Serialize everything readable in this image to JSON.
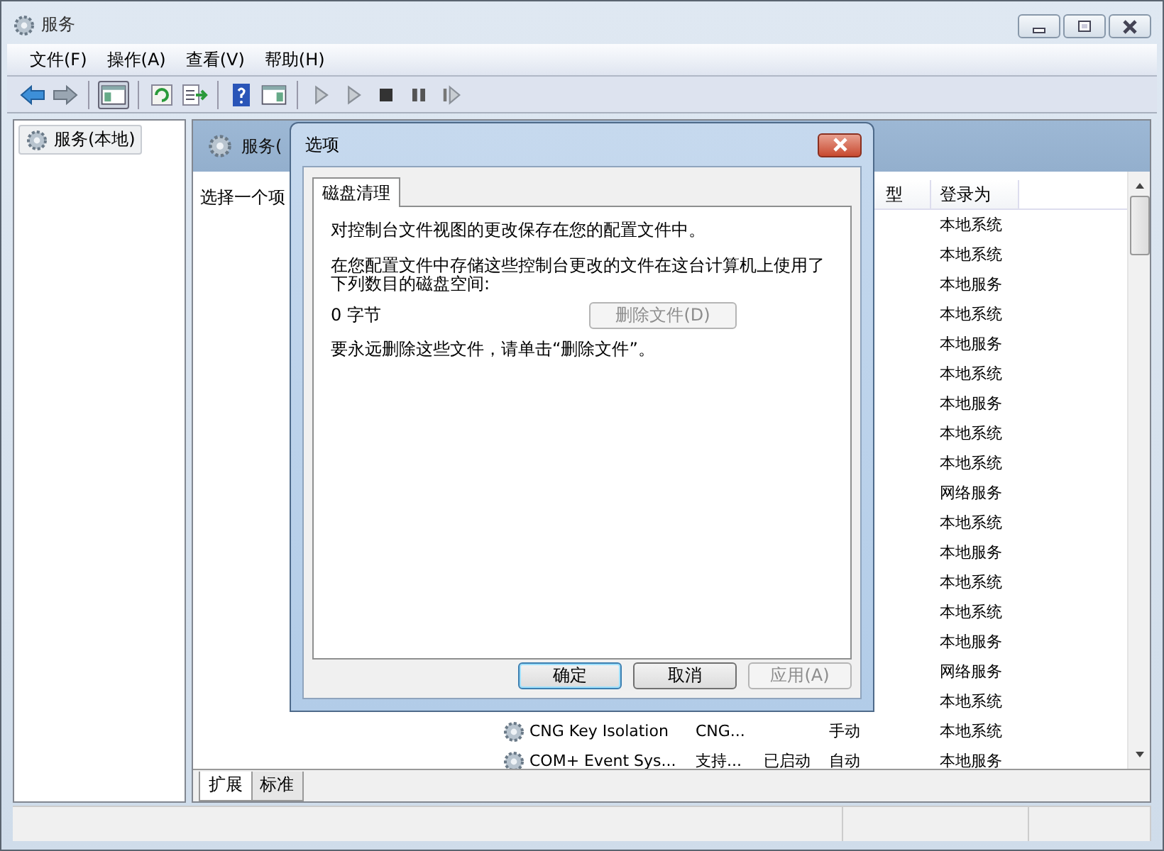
{
  "window": {
    "title": "服务"
  },
  "menu": [
    {
      "label": "文件(F)"
    },
    {
      "label": "操作(A)"
    },
    {
      "label": "查看(V)"
    },
    {
      "label": "帮助(H)"
    }
  ],
  "tree": [
    {
      "label": "服务(本地)",
      "selected": true
    }
  ],
  "pane": {
    "title": "服务(",
    "description": "选择一个项",
    "headers": [
      "型",
      "登录为"
    ],
    "rows": [
      {
        "login": "本地系统"
      },
      {
        "login": "本地系统"
      },
      {
        "login": "本地服务"
      },
      {
        "login": "本地系统"
      },
      {
        "login": "本地服务"
      },
      {
        "login": "本地系统"
      },
      {
        "login": "本地服务"
      },
      {
        "login": "本地系统"
      },
      {
        "login": "本地系统"
      },
      {
        "login": "网络服务"
      },
      {
        "login": "本地系统"
      },
      {
        "login": "本地服务"
      },
      {
        "login": "本地系统"
      },
      {
        "login": "本地系统"
      },
      {
        "login": "本地服务"
      },
      {
        "login": "网络服务"
      },
      {
        "login": "本地系统"
      },
      {
        "name": "CNG Key Isolation",
        "description": "CNG...",
        "startup": "手动",
        "login": "本地系统"
      },
      {
        "name": "COM+ Event Sys...",
        "description": "支持...",
        "status": "已启动",
        "startup": "自动",
        "login": "本地服务"
      }
    ]
  },
  "view_tabs": [
    {
      "label": "扩展",
      "selected": true
    },
    {
      "label": "标准",
      "selected": false
    }
  ],
  "dialog": {
    "title": "选项",
    "tabs": [
      {
        "label": "磁盘清理",
        "selected": true
      }
    ],
    "text_1": "对控制台文件视图的更改保存在您的配置文件中。",
    "text_2": "在您配置文件中存储这些控制台更改的文件在这台计算机上使用了下列数目的磁盘空间:",
    "size": "0 字节",
    "delete_button": {
      "label": "删除文件(D)",
      "disabled": true
    },
    "text_3": "要永远删除这些文件，请单击“删除文件”。",
    "buttons": [
      {
        "label": "确定",
        "default": true,
        "disabled": false
      },
      {
        "label": "取消",
        "default": false,
        "disabled": false
      },
      {
        "label": "应用(A)",
        "default": false,
        "disabled": true
      }
    ]
  }
}
